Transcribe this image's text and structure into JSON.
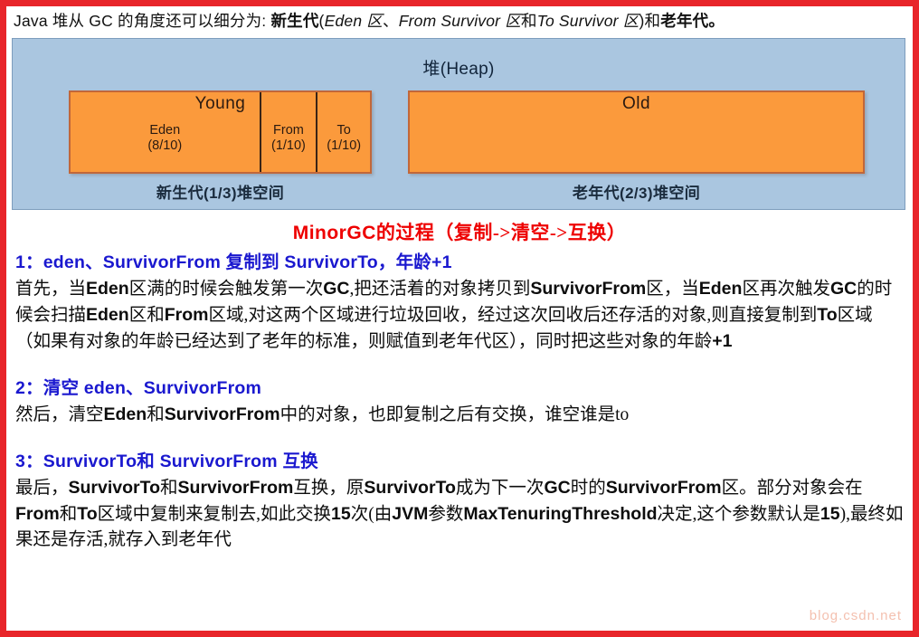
{
  "intro": {
    "prefix": "Java 堆从 GC 的角度还可以细分为: ",
    "young_bold": "新生代",
    "paren_open": "(",
    "eden_italic": "Eden 区",
    "sep1": "、",
    "from_italic": "From Survivor 区",
    "and1": "和",
    "to_italic": "To Survivor 区",
    "paren_close": ")",
    "and2": "和",
    "old_bold": "老年代",
    "period": "。"
  },
  "diagram": {
    "title": "堆(Heap)",
    "young": {
      "label": "Young",
      "segments": [
        {
          "name": "Eden",
          "ratio": "(8/10)"
        },
        {
          "name": "From",
          "ratio": "(1/10)"
        },
        {
          "name": "To",
          "ratio": "(1/10)"
        }
      ],
      "caption": "新生代(1/3)堆空间"
    },
    "old": {
      "label": "Old",
      "caption": "老年代(2/3)堆空间"
    },
    "colors": {
      "panel_bg": "#aac6e0",
      "region_fill": "#fb9a3c",
      "region_border": "#c1673a",
      "frame": "#e8252a"
    }
  },
  "minorgc_title": {
    "latin": "MinorGC",
    "cn": "的过程（复制->清空->互换）"
  },
  "steps": [
    {
      "heading_num": "1：",
      "heading_text": "eden、SurvivorFrom 复制到 SurvivorTo，年龄+1",
      "paragraph": "首先，当Eden区满的时候会触发第一次GC,把还活着的对象拷贝到SurvivorFrom区，当Eden区再次触发GC的时候会扫描Eden区和From区域,对这两个区域进行垃圾回收，经过这次回收后还存活的对象,则直接复制到To区域（如果有对象的年龄已经达到了老年的标准，则赋值到老年代区），同时把这些对象的年龄+1"
    },
    {
      "heading_num": "2：",
      "heading_text": "清空 eden、SurvivorFrom",
      "paragraph": "然后，清空Eden和SurvivorFrom中的对象，也即复制之后有交换，谁空谁是to"
    },
    {
      "heading_num": "3：",
      "heading_text": "SurvivorTo和 SurvivorFrom 互换",
      "paragraph": "最后，SurvivorTo和SurvivorFrom互换，原SurvivorTo成为下一次GC时的SurvivorFrom区。部分对象会在From和To区域中复制来复制去,如此交换15次(由JVM参数MaxTenuringThreshold决定,这个参数默认是15),最终如果还是存活,就存入到老年代"
    }
  ],
  "watermark": "blog.csdn.net"
}
